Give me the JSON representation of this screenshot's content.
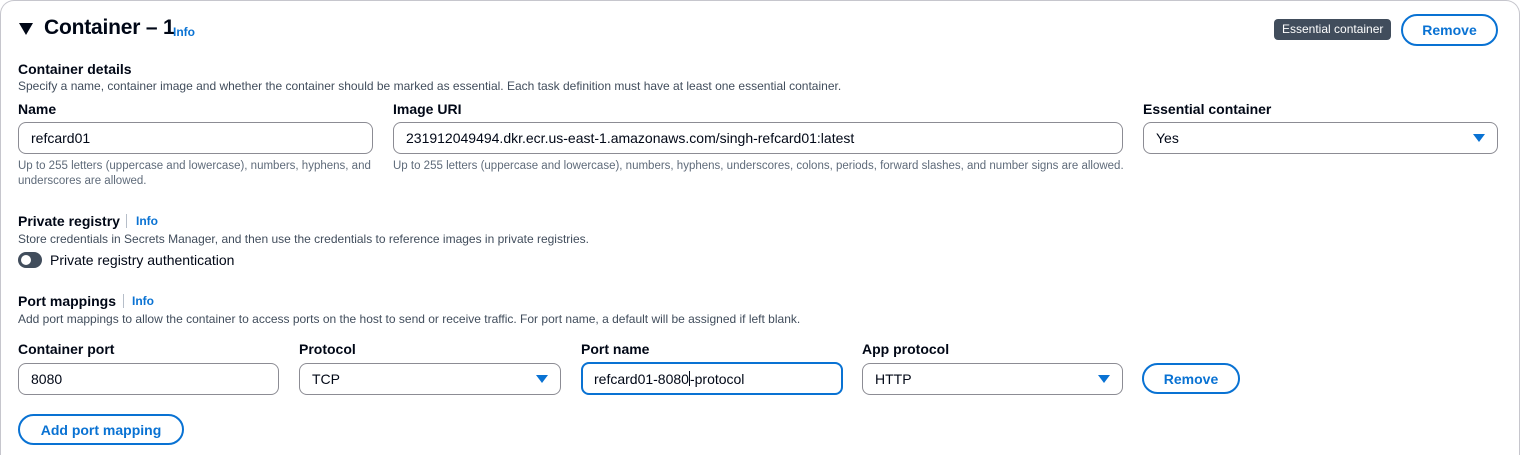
{
  "header": {
    "title": "Container – 1",
    "info": "Info",
    "badge": "Essential container",
    "remove_label": "Remove"
  },
  "container_details": {
    "title": "Container details",
    "description": "Specify a name, container image and whether the container should be marked as essential. Each task definition must have at least one essential container.",
    "name": {
      "label": "Name",
      "value": "refcard01",
      "constraint": "Up to 255 letters (uppercase and lowercase), numbers, hyphens, and underscores are allowed."
    },
    "image_uri": {
      "label": "Image URI",
      "value": "231912049494.dkr.ecr.us-east-1.amazonaws.com/singh-refcard01:latest",
      "constraint": "Up to 255 letters (uppercase and lowercase), numbers, hyphens, underscores, colons, periods, forward slashes, and number signs are allowed."
    },
    "essential": {
      "label": "Essential container",
      "value": "Yes"
    }
  },
  "private_registry": {
    "title": "Private registry",
    "info": "Info",
    "description": "Store credentials in Secrets Manager, and then use the credentials to reference images in private registries.",
    "toggle_label": "Private registry authentication",
    "toggle_on": false
  },
  "port_mappings": {
    "title": "Port mappings",
    "info": "Info",
    "description": "Add port mappings to allow the container to access ports on the host to send or receive traffic. For port name, a default will be assigned if left blank.",
    "container_port": {
      "label": "Container port",
      "value": "8080"
    },
    "protocol": {
      "label": "Protocol",
      "value": "TCP"
    },
    "port_name": {
      "label": "Port name",
      "value_before_cursor": "refcard01-8080",
      "value_after_cursor": "-protocol"
    },
    "app_protocol": {
      "label": "App protocol",
      "value": "HTTP"
    },
    "remove_label": "Remove",
    "add_label": "Add port mapping"
  },
  "colors": {
    "accent": "#0972d3",
    "text": "#000716",
    "badge_bg": "#414d5c",
    "border": "#8c8c94"
  }
}
